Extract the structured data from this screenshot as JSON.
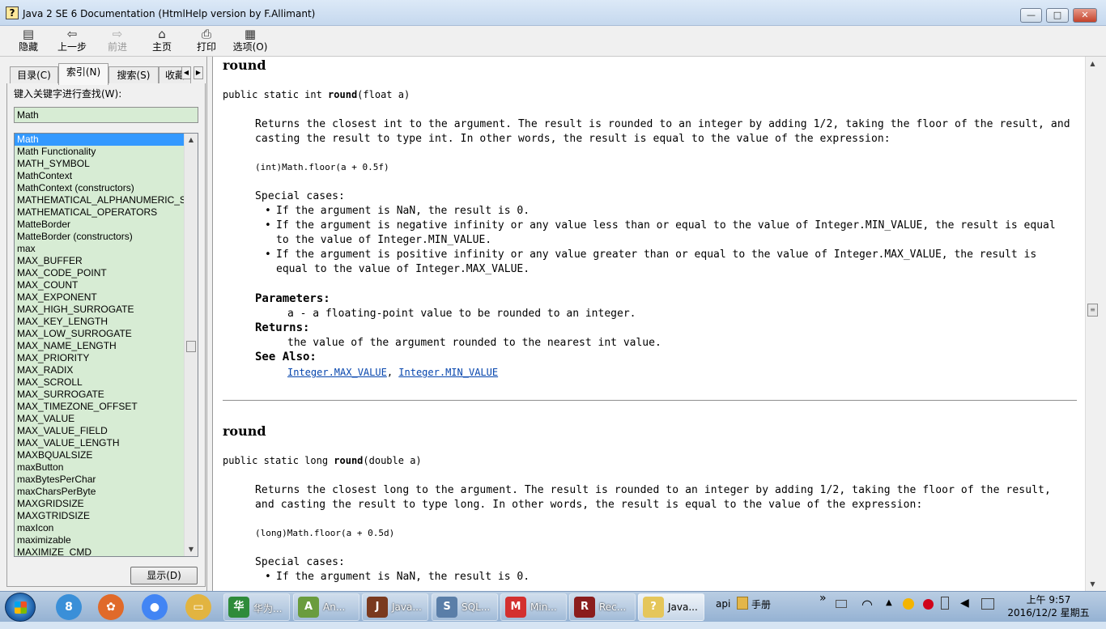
{
  "window": {
    "title": "Java 2 SE 6 Documentation (HtmlHelp version by F.Allimant)",
    "minimize_glyph": "—",
    "maximize_glyph": "□",
    "close_glyph": "✕"
  },
  "toolbar": {
    "hide": "隐藏",
    "back": "上一步",
    "forward": "前进",
    "home": "主页",
    "print": "打印",
    "options": "选项(O)",
    "icons": {
      "hide": "▤",
      "back": "⇦",
      "forward": "⇨",
      "home": "⌂",
      "print": "⎙",
      "options": "▦"
    }
  },
  "left_pane": {
    "tabs": [
      "目录(C)",
      "索引(N)",
      "搜索(S)",
      "收藏"
    ],
    "active_tab": "索引(N)",
    "keyword_label": "键入关键字进行查找(W):",
    "keyword_value": "Math",
    "show_button": "显示(D)",
    "index_items": [
      "Math",
      "Math Functionality",
      "MATH_SYMBOL",
      "MathContext",
      "MathContext (constructors)",
      "MATHEMATICAL_ALPHANUMERIC_S",
      "MATHEMATICAL_OPERATORS",
      "MatteBorder",
      "MatteBorder (constructors)",
      "max",
      "MAX_BUFFER",
      "MAX_CODE_POINT",
      "MAX_COUNT",
      "MAX_EXPONENT",
      "MAX_HIGH_SURROGATE",
      "MAX_KEY_LENGTH",
      "MAX_LOW_SURROGATE",
      "MAX_NAME_LENGTH",
      "MAX_PRIORITY",
      "MAX_RADIX",
      "MAX_SCROLL",
      "MAX_SURROGATE",
      "MAX_TIMEZONE_OFFSET",
      "MAX_VALUE",
      "MAX_VALUE_FIELD",
      "MAX_VALUE_LENGTH",
      "MAXBQUALSIZE",
      "maxButton",
      "maxBytesPerChar",
      "maxCharsPerByte",
      "MAXGRIDSIZE",
      "MAXGTRIDSIZE",
      "maxIcon",
      "maximizable",
      "MAXIMIZE_CMD"
    ],
    "selected_index": 0
  },
  "content": {
    "section1": {
      "heading": "round",
      "sig_prefix": "public static int ",
      "sig_name": "round",
      "sig_suffix": "(float a)",
      "desc_line1": "Returns the closest int to the argument. The result is rounded to an integer by adding 1/2, taking the floor of the result, and",
      "desc_line2": "casting the result to type int. In other words, the result is equal to the value of the expression:",
      "code": "(int)Math.floor(a + 0.5f)",
      "special_cases": "Special cases:",
      "bullet1": "If the argument is NaN, the result is 0.",
      "bullet2_line1": "If the argument is negative infinity or any value less than or equal to the value of Integer.MIN_VALUE, the result is equal",
      "bullet2_line2": "to the value of Integer.MIN_VALUE.",
      "bullet3_line1": "If the argument is positive infinity or any value greater than or equal to the value of Integer.MAX_VALUE, the result is",
      "bullet3_line2": "equal to the value of Integer.MAX_VALUE.",
      "parameters_label": "Parameters:",
      "parameters_text": "a - a floating-point value to be rounded to an integer.",
      "returns_label": "Returns:",
      "returns_text": "the value of the argument rounded to the nearest int value.",
      "see_also_label": "See Also:",
      "see_also_link1": "Integer.MAX_VALUE",
      "see_also_sep": ", ",
      "see_also_link2": "Integer.MIN_VALUE"
    },
    "section2": {
      "heading": "round",
      "sig_prefix": "public static long ",
      "sig_name": "round",
      "sig_suffix": "(double a)",
      "desc_line1": "Returns the closest long to the argument. The result is rounded to an integer by adding 1/2, taking the floor of the result,",
      "desc_line2": "and casting the result to type long. In other words, the result is equal to the value of the expression:",
      "code": "(long)Math.floor(a + 0.5d)",
      "special_cases": "Special cases:",
      "bullet1": "If the argument is NaN, the result is 0."
    }
  },
  "taskbar": {
    "items": [
      {
        "label": "华为...",
        "color": "#2e8b3a",
        "icon": "华"
      },
      {
        "label": "An...",
        "color": "#6a9c3e",
        "icon": "A"
      },
      {
        "label": "Java...",
        "color": "#7a3a1f",
        "icon": "J"
      },
      {
        "label": "SQL...",
        "color": "#5a7ea8",
        "icon": "S"
      },
      {
        "label": "Min...",
        "color": "#d3302f",
        "icon": "M"
      },
      {
        "label": "Rec...",
        "color": "#8b1d1d",
        "icon": "R"
      },
      {
        "label": "Java...",
        "color": "#e5c65a",
        "icon": "?"
      }
    ],
    "pinned": [
      {
        "icon": "8",
        "color": "#3a8fd8"
      },
      {
        "icon": "✿",
        "color": "#e06a2a"
      },
      {
        "icon": "●",
        "color": "#4285f4"
      },
      {
        "icon": "▭",
        "color": "#e2b440"
      }
    ],
    "tray_api": "api",
    "tray_folder": "手册",
    "tray_chevron": "»",
    "clock_time": "上午 9:57",
    "clock_date": "2016/12/2 星期五"
  }
}
